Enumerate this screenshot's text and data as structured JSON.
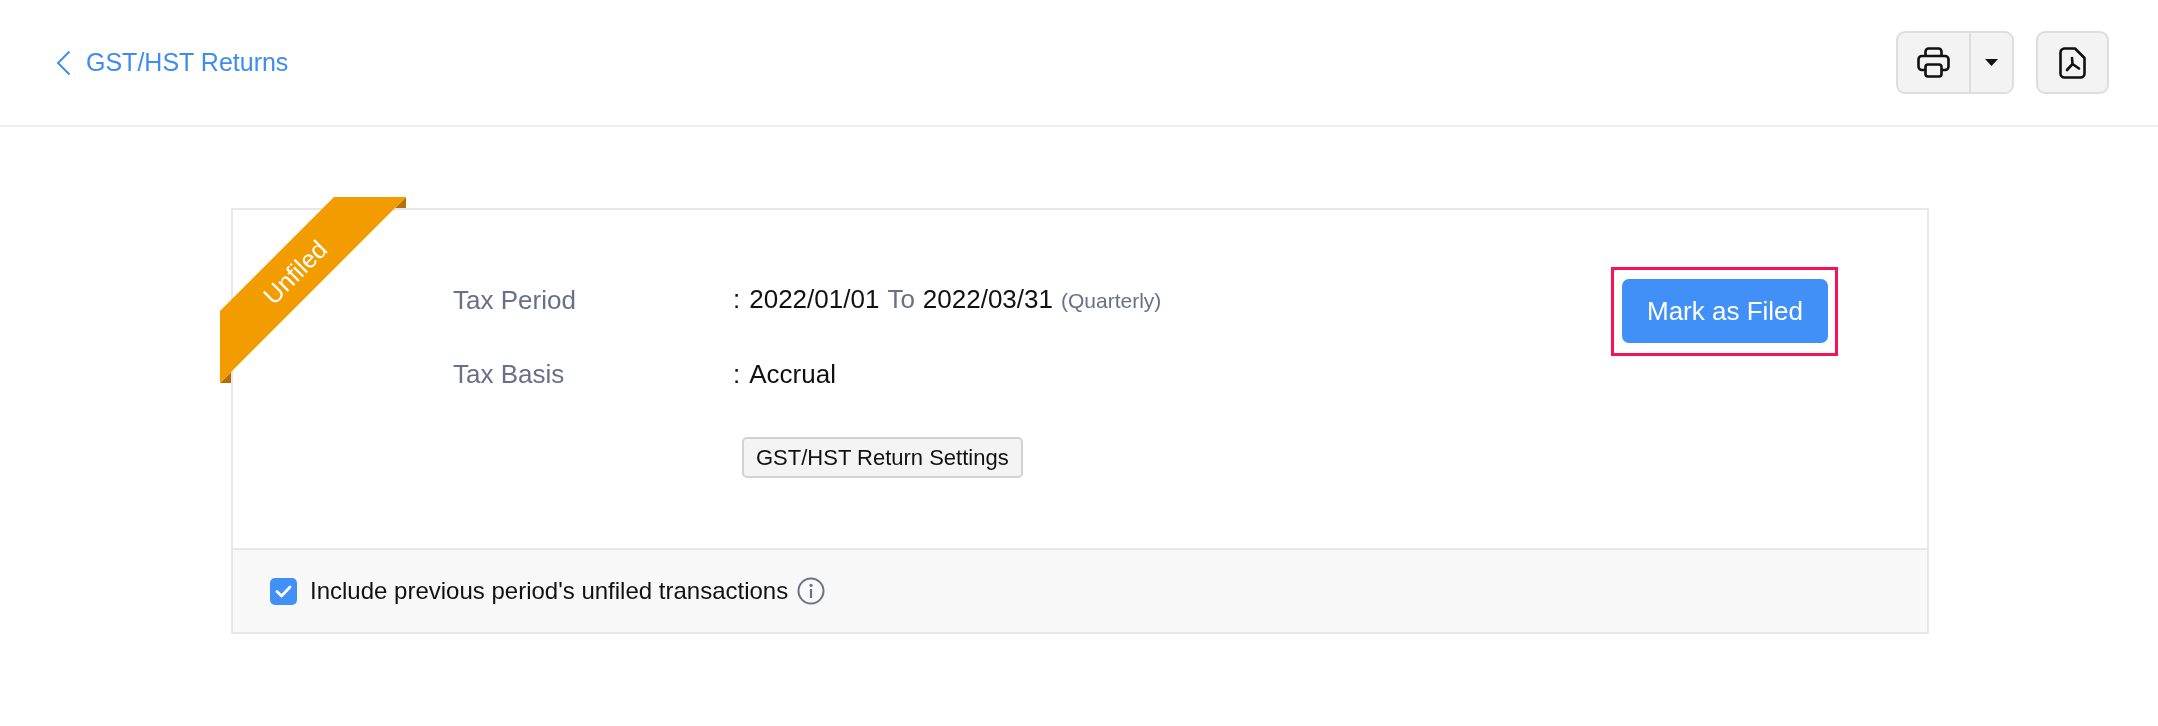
{
  "header": {
    "back_link": {
      "label": "GST/HST Returns"
    }
  },
  "return_card": {
    "status_ribbon": {
      "label": "Unfiled"
    },
    "fields": [
      {
        "label": "Tax Period",
        "separator": ":",
        "parts": [
          {
            "kind": "value",
            "text": "2022/01/01"
          },
          {
            "kind": "connector",
            "text": "To"
          },
          {
            "kind": "value",
            "text": "2022/03/31"
          },
          {
            "kind": "note",
            "text": "(Quarterly)"
          }
        ]
      },
      {
        "label": "Tax Basis",
        "separator": ":",
        "parts": [
          {
            "kind": "value",
            "text": "Accrual"
          }
        ]
      }
    ],
    "settings_button": {
      "label": "GST/HST Return Settings"
    },
    "primary_action": {
      "label": "Mark as Filed",
      "highlighted": true
    },
    "footer": {
      "include_previous": {
        "label": "Include previous period's unfiled transactions",
        "checked": true
      }
    }
  }
}
